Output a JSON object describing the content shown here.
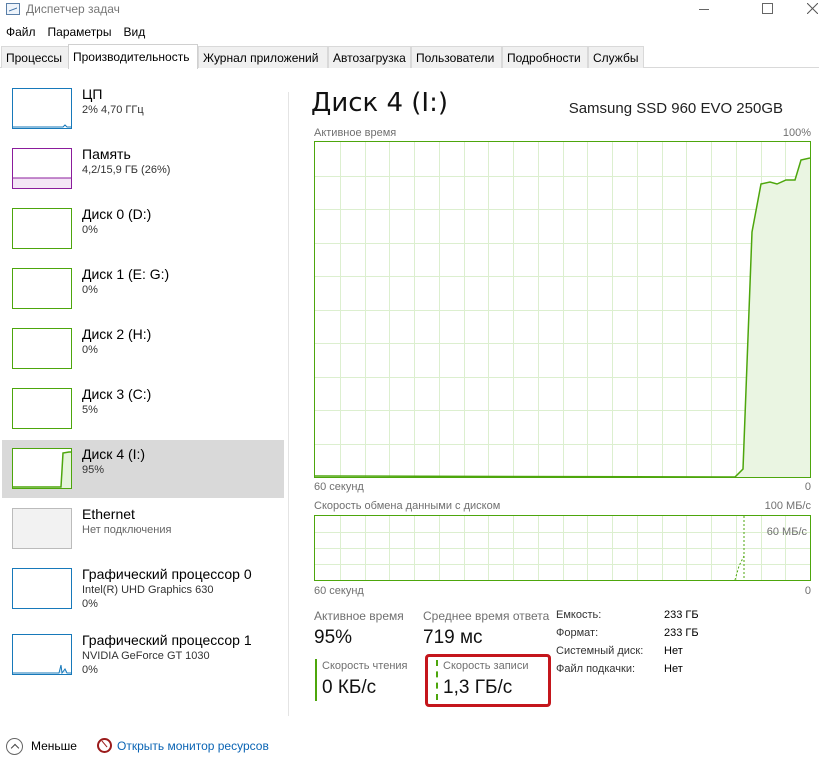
{
  "window": {
    "title": "Диспетчер задач",
    "minimize_symbol": "—",
    "close_symbol": "✕"
  },
  "menu": [
    "Файл",
    "Параметры",
    "Вид"
  ],
  "tabs": [
    "Процессы",
    "Производительность",
    "Журнал приложений",
    "Автозагрузка",
    "Пользователи",
    "Подробности",
    "Службы"
  ],
  "active_tab": "Производительность",
  "sidebar": [
    {
      "name": "ЦП",
      "line1": "2% 4,70 ГГц",
      "line2": "",
      "color": "#1779ba",
      "usage": 2
    },
    {
      "name": "Память",
      "line1": "4,2/15,9 ГБ (26%)",
      "line2": "",
      "color": "#8b1c9c",
      "usage": 26
    },
    {
      "name": "Диск 0 (D:)",
      "line1": "0%",
      "line2": "",
      "color": "#4da60c",
      "usage": 0
    },
    {
      "name": "Диск 1 (E: G:)",
      "line1": "0%",
      "line2": "",
      "color": "#4da60c",
      "usage": 0
    },
    {
      "name": "Диск 2 (H:)",
      "line1": "0%",
      "line2": "",
      "color": "#4da60c",
      "usage": 0
    },
    {
      "name": "Диск 3 (C:)",
      "line1": "5%",
      "line2": "",
      "color": "#4da60c",
      "usage": 5
    },
    {
      "name": "Диск 4 (I:)",
      "line1": "95%",
      "line2": "",
      "color": "#4da60c",
      "usage": 95,
      "selected": true
    },
    {
      "name": "Ethernet",
      "line1": "Нет подключения",
      "line2": "",
      "color": "#a8a8a8",
      "usage": 0
    },
    {
      "name": "Графический процессор 0",
      "line1": "Intel(R) UHD Graphics 630",
      "line2": "0%",
      "color": "#1779ba",
      "usage": 0
    },
    {
      "name": "Графический процессор 1",
      "line1": "NVIDIA GeForce GT 1030",
      "line2": "0%",
      "color": "#1779ba",
      "usage": 0
    }
  ],
  "main": {
    "title": "Диск 4 (I:)",
    "model": "Samsung SSD 960 EVO 250GB",
    "active_time_graph": {
      "label": "Активное время",
      "max_label": "100%",
      "x_left": "60 секунд",
      "x_right": "0"
    },
    "transfer_graph": {
      "label": "Скорость обмена данными с диском",
      "max_label": "100 МБ/с",
      "mid_label": "60 МБ/с",
      "x_left": "60 секунд",
      "x_right": "0"
    },
    "stats": {
      "active_time_label": "Активное время",
      "active_time_value": "95%",
      "response_label": "Среднее время ответа",
      "response_value": "719 мс",
      "read_label": "Скорость чтения",
      "read_value": "0 КБ/с",
      "write_label": "Скорость записи",
      "write_value": "1,3 ГБ/с"
    },
    "info": [
      {
        "label": "Емкость:",
        "value": "233 ГБ"
      },
      {
        "label": "Формат:",
        "value": "233 ГБ"
      },
      {
        "label": "Системный диск:",
        "value": "Нет"
      },
      {
        "label": "Файл подкачки:",
        "value": "Нет"
      }
    ]
  },
  "footer": {
    "less_label": "Меньше",
    "resmon_label": "Открыть монитор ресурсов"
  },
  "colors": {
    "disk_green": "#4da60c",
    "highlight_red": "#c4161c",
    "link_blue": "#0a64b4",
    "selected_bg": "#d9d9d9"
  }
}
